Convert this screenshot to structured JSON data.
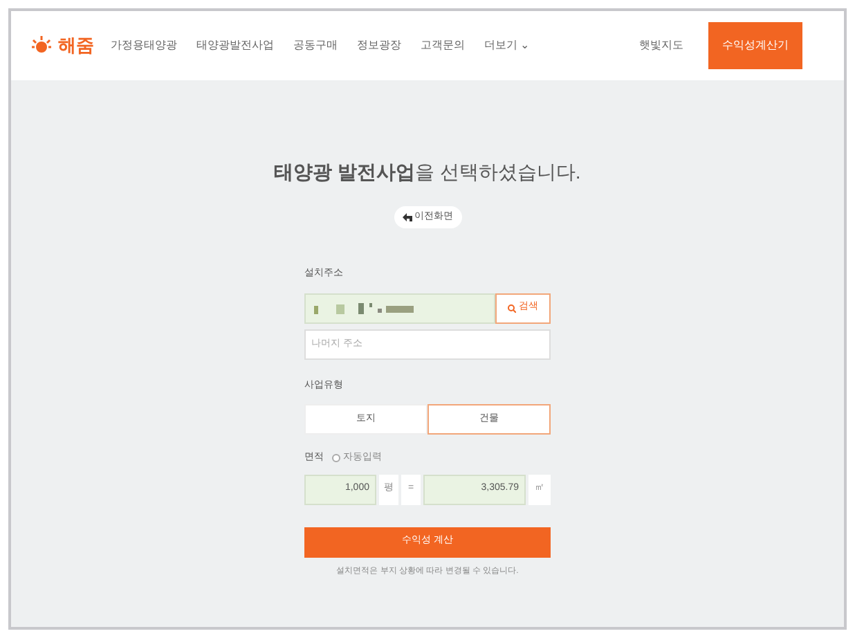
{
  "header": {
    "logo": "해줌",
    "nav": [
      {
        "label": "가정용태양광",
        "selected": false
      },
      {
        "label": "태양광발전사업",
        "selected": false
      },
      {
        "label": "공동구매",
        "selected": false
      },
      {
        "label": "정보광장",
        "selected": false
      },
      {
        "label": "고객문의",
        "selected": false
      },
      {
        "label": "더보기 ⌄",
        "selected": false
      }
    ],
    "map_link": "햇빛지도",
    "calculator_button": "수익성계산기"
  },
  "title": "**태양광 발전사업**을 선택하셨습니다.",
  "back_button": "이전화면",
  "address": {
    "label": "설치주소",
    "search_button": "검색",
    "detail_placeholder": "나머지 주소"
  },
  "business_type": {
    "label": "사업유형",
    "options": [
      {
        "label": "토지",
        "selected": false
      },
      {
        "label": "건물",
        "selected": true
      }
    ]
  },
  "area": {
    "label": "면적",
    "auto_fill": {
      "label": "자동입력",
      "checked": false
    },
    "pyeong": "1,000",
    "pyeong_unit": "평",
    "equals": "=",
    "square_meters": "3,305.79",
    "sqm_unit": "㎡"
  },
  "submit_button": "수익성 계산",
  "note": "설치면적은 부지 상황에 따라 변경될 수 있습니다."
}
